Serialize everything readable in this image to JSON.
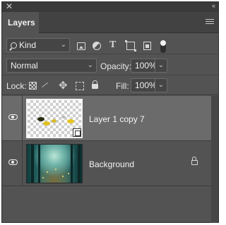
{
  "panel": {
    "tab_label": "Layers",
    "close_glyph": "✕",
    "collapse_glyph": "‹‹"
  },
  "filter": {
    "kind_label": "Kind",
    "icons": [
      "pixel-filter-icon",
      "adjustment-filter-icon",
      "type-filter-icon",
      "shape-filter-icon",
      "smart-object-filter-icon"
    ],
    "toggle_on": true
  },
  "blending": {
    "mode": "Normal",
    "opacity_label": "Opacity:",
    "opacity_value": "100%"
  },
  "locks": {
    "lock_label": "Lock:",
    "icons": [
      "lock-pixels-icon",
      "lock-image-icon",
      "lock-position-icon",
      "lock-artboard-icon",
      "lock-all-icon"
    ],
    "fill_label": "Fill:",
    "fill_value": "100%"
  },
  "layers": [
    {
      "name": "Layer 1 copy 7",
      "visible": true,
      "selected": true,
      "smart_object": true,
      "locked": false
    },
    {
      "name": "Background",
      "visible": true,
      "selected": false,
      "smart_object": false,
      "locked": true
    }
  ],
  "colors": {
    "panel_bg": "#535353",
    "selected_row": "#6b6b6b",
    "text": "#f0f0f0"
  }
}
